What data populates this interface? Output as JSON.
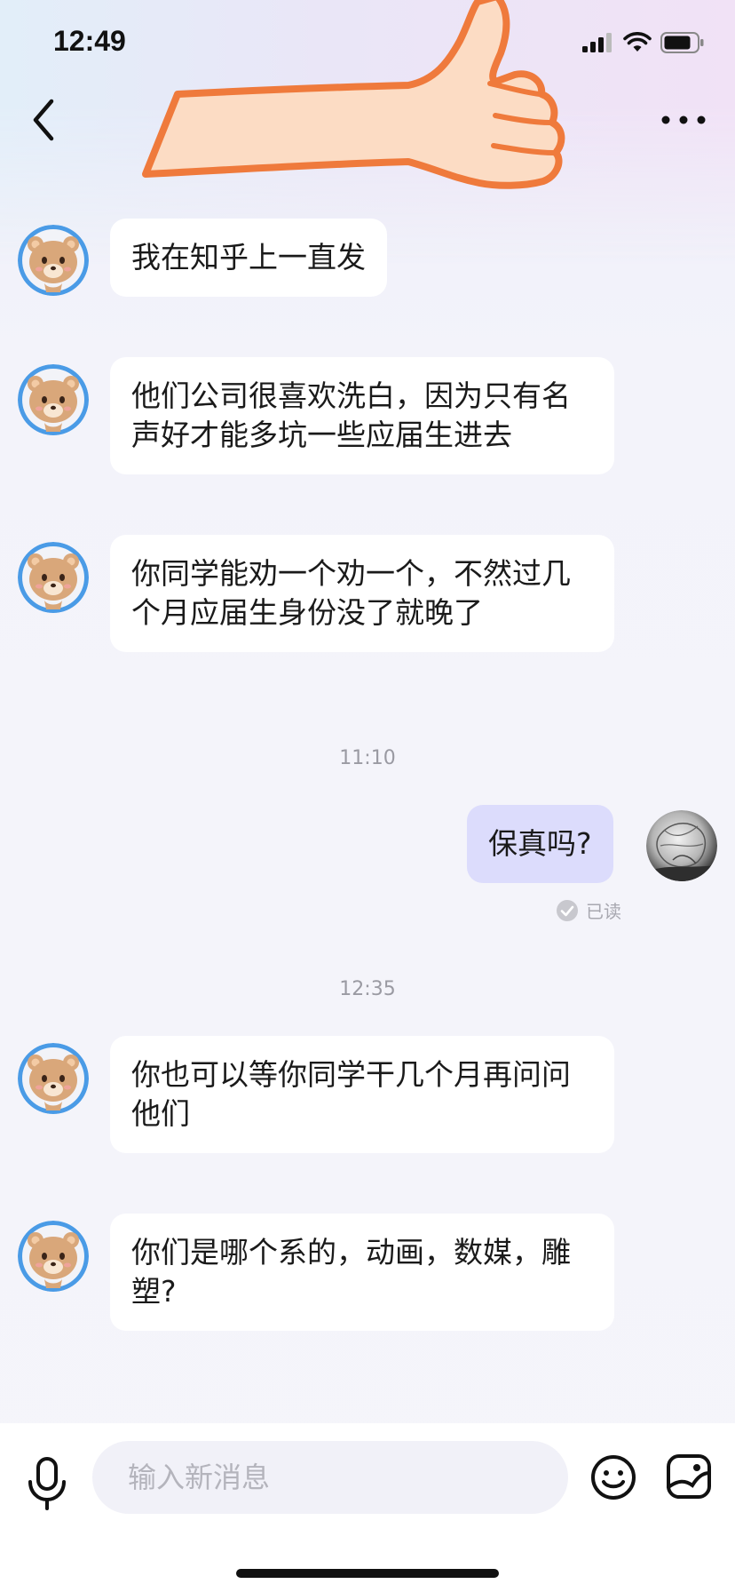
{
  "status_bar": {
    "time": "12:49"
  },
  "header": {
    "back_icon": "chevron-left-icon",
    "more_icon": "more-dots-icon",
    "decoration": "thumbs-up-hand"
  },
  "messages": [
    {
      "sender": "other",
      "text": "我在知乎上一直发"
    },
    {
      "sender": "other",
      "text": "他们公司很喜欢洗白，因为只有名\n声好才能多坑一些应届生进去"
    },
    {
      "sender": "other",
      "text": "你同学能劝一个劝一个，不然过几\n个月应届生身份没了就晚了"
    },
    {
      "timestamp": "11:10"
    },
    {
      "sender": "me",
      "text": "保真吗?",
      "status": "已读"
    },
    {
      "timestamp": "12:35"
    },
    {
      "sender": "other",
      "text": "你也可以等你同学干几个月再问问\n他们"
    },
    {
      "sender": "other",
      "text": "你们是哪个系的，动画，数媒，雕\n塑?"
    }
  ],
  "input_bar": {
    "placeholder": "输入新消息",
    "mic_icon": "microphone-icon",
    "emoji_icon": "emoji-icon",
    "image_icon": "image-icon"
  },
  "colors": {
    "my_bubble": "#dcdcfc",
    "other_bubble": "#ffffff",
    "avatar_ring": "#4a9be6"
  }
}
